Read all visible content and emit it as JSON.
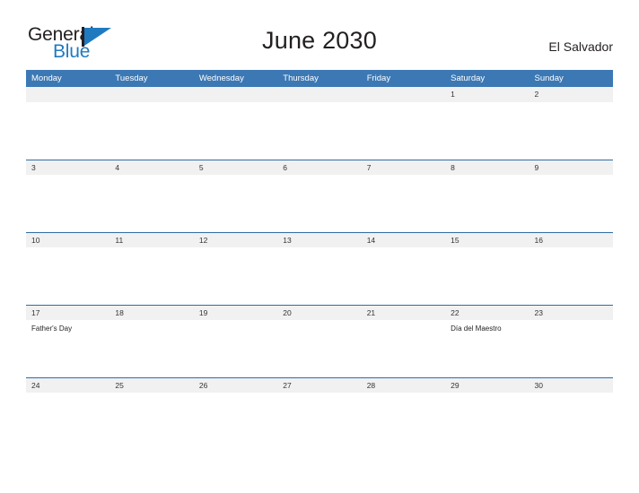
{
  "brand": {
    "name_part1": "General",
    "name_part2": "Blue",
    "accent_color": "#1f7ac0",
    "logo_icon": "triangle-flag-icon"
  },
  "header": {
    "title": "June 2030",
    "region": "El Salvador"
  },
  "theme": {
    "header_blue": "#3c78b4",
    "row_divider_blue": "#2e6da4",
    "date_strip_gray": "#f1f1f1",
    "text_dark": "#231f20"
  },
  "calendar": {
    "weekdays": [
      "Monday",
      "Tuesday",
      "Wednesday",
      "Thursday",
      "Friday",
      "Saturday",
      "Sunday"
    ],
    "weeks": [
      [
        {
          "date": "",
          "events": []
        },
        {
          "date": "",
          "events": []
        },
        {
          "date": "",
          "events": []
        },
        {
          "date": "",
          "events": []
        },
        {
          "date": "",
          "events": []
        },
        {
          "date": "1",
          "events": []
        },
        {
          "date": "2",
          "events": []
        }
      ],
      [
        {
          "date": "3",
          "events": []
        },
        {
          "date": "4",
          "events": []
        },
        {
          "date": "5",
          "events": []
        },
        {
          "date": "6",
          "events": []
        },
        {
          "date": "7",
          "events": []
        },
        {
          "date": "8",
          "events": []
        },
        {
          "date": "9",
          "events": []
        }
      ],
      [
        {
          "date": "10",
          "events": []
        },
        {
          "date": "11",
          "events": []
        },
        {
          "date": "12",
          "events": []
        },
        {
          "date": "13",
          "events": []
        },
        {
          "date": "14",
          "events": []
        },
        {
          "date": "15",
          "events": []
        },
        {
          "date": "16",
          "events": []
        }
      ],
      [
        {
          "date": "17",
          "events": [
            "Father's Day"
          ]
        },
        {
          "date": "18",
          "events": []
        },
        {
          "date": "19",
          "events": []
        },
        {
          "date": "20",
          "events": []
        },
        {
          "date": "21",
          "events": []
        },
        {
          "date": "22",
          "events": [
            "Día del Maestro"
          ]
        },
        {
          "date": "23",
          "events": []
        }
      ],
      [
        {
          "date": "24",
          "events": []
        },
        {
          "date": "25",
          "events": []
        },
        {
          "date": "26",
          "events": []
        },
        {
          "date": "27",
          "events": []
        },
        {
          "date": "28",
          "events": []
        },
        {
          "date": "29",
          "events": []
        },
        {
          "date": "30",
          "events": []
        }
      ]
    ]
  }
}
